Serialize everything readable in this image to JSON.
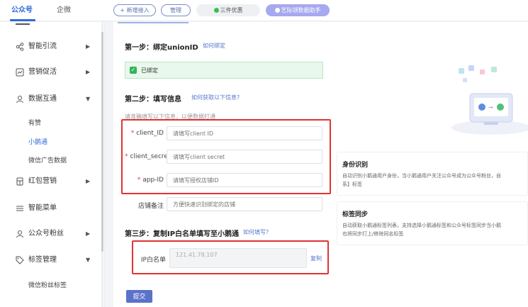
{
  "topbar": {
    "tabs": [
      "公众号",
      "企微"
    ],
    "buttons": {
      "add_access": "+ 新增接入",
      "manage": "管理",
      "three_piece": "三件优惠",
      "assistant": "艺际领数据助手"
    }
  },
  "sidebar": {
    "items": [
      {
        "label": "智能引流",
        "icon": "share-icon"
      },
      {
        "label": "营销促活",
        "icon": "chart-icon"
      },
      {
        "label": "数据互通",
        "icon": "user-icon"
      },
      {
        "label": "红包营销",
        "icon": "redpacket-icon"
      },
      {
        "label": "智能菜单",
        "icon": "menu-icon"
      },
      {
        "label": "公众号粉丝",
        "icon": "user-icon"
      },
      {
        "label": "标签管理",
        "icon": "tag-icon"
      }
    ],
    "subitems": {
      "youzan": "有赞",
      "xiaoe": "小鹅通",
      "wechat_ads": "微信广告数据",
      "fan_tags": "微信粉丝标签"
    }
  },
  "step1": {
    "title": "第一步：绑定unionID",
    "help": "如何绑定",
    "status": "已绑定"
  },
  "step2": {
    "title": "第二步：填写信息",
    "help": "如何获取以下信息?",
    "hint": "请准确填写以下信息，以便数据打通",
    "fields": [
      {
        "label": "client_ID",
        "required": true,
        "placeholder": "请填写client ID"
      },
      {
        "label": "client_secret",
        "required": true,
        "placeholder": "请填写client secret"
      },
      {
        "label": "app-ID",
        "required": true,
        "placeholder": "请填写授权店铺ID"
      },
      {
        "label": "店铺备注",
        "required": false,
        "placeholder": "方便快速识别绑定的店铺"
      }
    ]
  },
  "step3": {
    "title": "第三步：复制IP白名单填写至小鹅通",
    "help": "如何填写?",
    "ip_label": "IP白名单",
    "ip_value": "121.41.78.107",
    "copy": "复制"
  },
  "submit": "提交",
  "right_panel": {
    "identity": {
      "title": "身份识别",
      "desc1": "自动识别小鹅通用户身份，当小鹅通用户关注公众号成为公众号粉丝，自",
      "desc2": "系】标签"
    },
    "tag_sync": {
      "title": "标签同步",
      "desc1": "自动获取小鹅通标签列表，支持选择小鹅通标签和公众号标签同步当小鹅",
      "desc2": "也将同步打上/移除同名标签"
    }
  },
  "colors": {
    "accent": "#2f6bd8",
    "submit": "#5b72c9",
    "success_bg": "#e8f8ec",
    "highlight": "#e03334"
  }
}
